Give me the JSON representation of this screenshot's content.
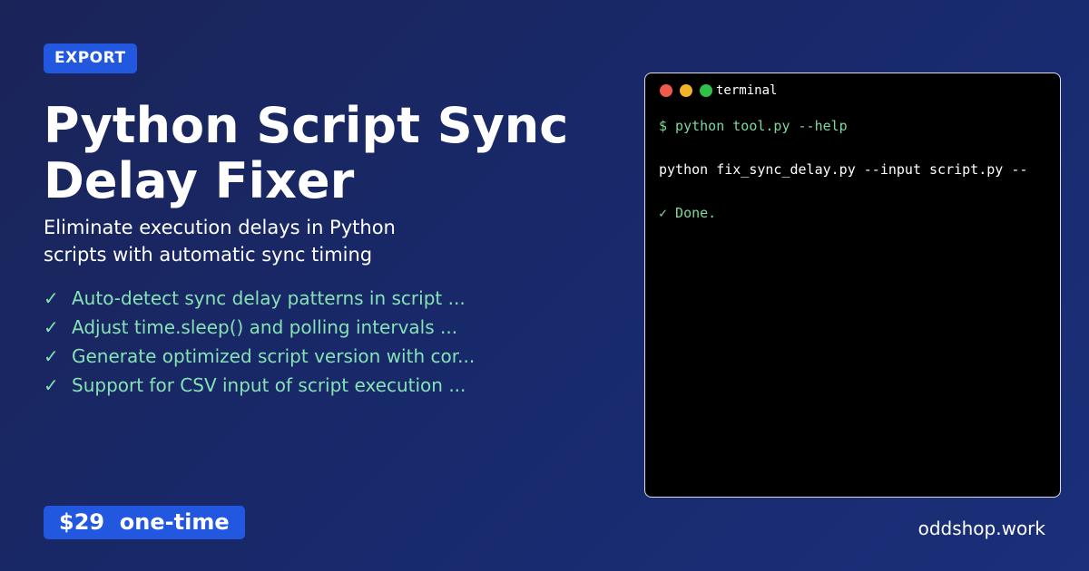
{
  "badge": "EXPORT",
  "title": "Python Script Sync Delay Fixer",
  "subtitle": "Eliminate execution delays in Python scripts with automatic sync timing",
  "check_glyph": "✓",
  "features": [
    "Auto-detect sync delay patterns in script ...",
    "Adjust time.sleep() and polling intervals ...",
    "Generate optimized script version with cor...",
    "Support for CSV input of script execution ..."
  ],
  "price": "$29  one-time",
  "domain": "oddshop.work",
  "terminal": {
    "title": "terminal",
    "command": "$ python tool.py --help",
    "output": "python fix_sync_delay.py --input script.py --",
    "done": "✓ Done."
  },
  "colors": {
    "accent": "#2257e0",
    "feature_text": "#86e2b4",
    "background_start": "#1a2459",
    "background_end": "#1b2f7a",
    "terminal_bg": "#000000",
    "dot_red": "#f05a4c",
    "dot_yellow": "#f3b329",
    "dot_green": "#2ec24b"
  }
}
